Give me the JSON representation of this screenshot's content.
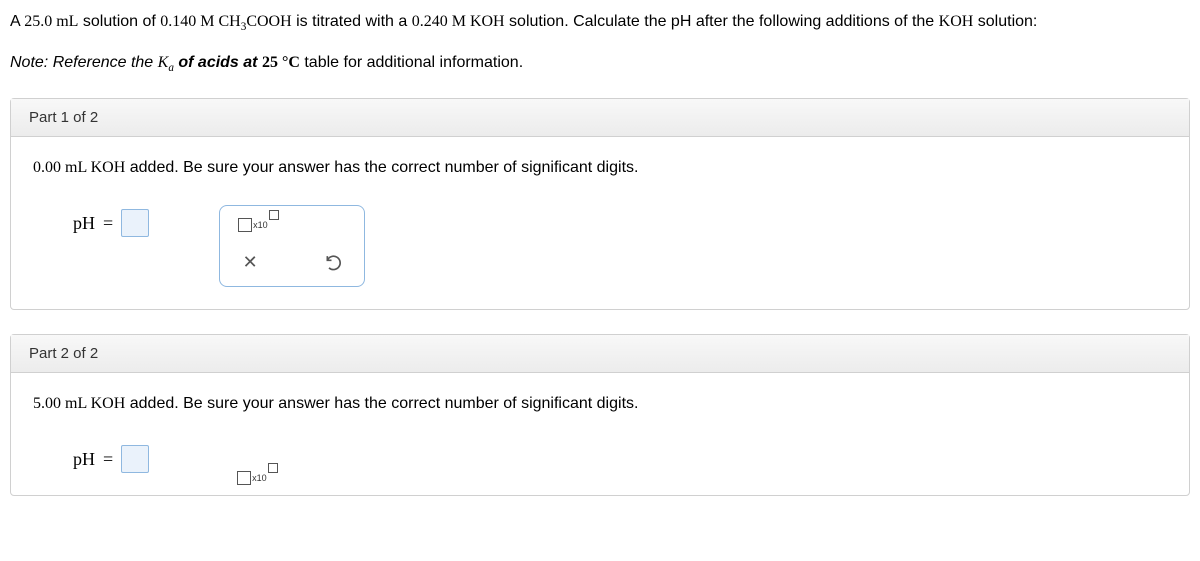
{
  "problem": {
    "pre1": "A ",
    "vol1": "25.0 mL",
    "mid1": " solution of ",
    "conc1": "0.140 M CH",
    "sub3": "3",
    "cooh": "COOH",
    "mid2": " is titrated with a ",
    "conc2": "0.240 M KOH",
    "tail": " solution. Calculate the pH after the following additions of the ",
    "koh": "KOH",
    "tail2": " solution:"
  },
  "note": {
    "prefix": "Note:",
    "mid": " Reference the ",
    "ka_k": "K",
    "ka_a": "a",
    "bold": " of acids at ",
    "temp": "25 °C",
    "suffix": " table for additional information."
  },
  "parts": [
    {
      "header": "Part 1 of 2",
      "vol": "0.00 mL KOH",
      "prompt_tail": " added. Be sure your answer has the correct number of significant digits.",
      "label_var": "pH",
      "eq": "="
    },
    {
      "header": "Part 2 of 2",
      "vol": "5.00 mL KOH",
      "prompt_tail": " added. Be sure your answer has the correct number of significant digits.",
      "label_var": "pH",
      "eq": "="
    }
  ],
  "tools": {
    "x10": "x10",
    "clear": "✕"
  }
}
